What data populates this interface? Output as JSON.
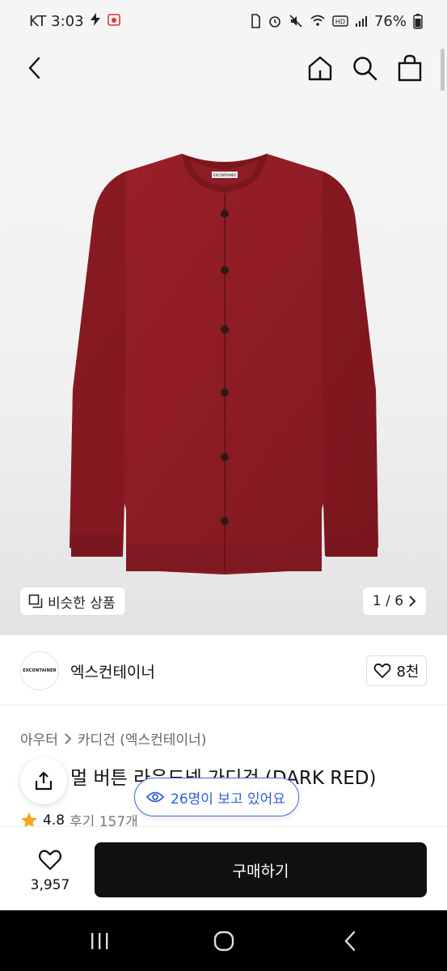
{
  "status_bar": {
    "carrier_time": "KT 3:03",
    "battery": "76%"
  },
  "nav": {
    "icons": [
      "back-arrow-icon",
      "home-icon",
      "search-icon",
      "shopping-bag-icon"
    ]
  },
  "product_image": {
    "similar_label": "비슷한 상품",
    "pager": "1 / 6",
    "garment_label": "EXCONTAINER",
    "colors": {
      "cardigan": "#8e1c24",
      "cardigan_shadow": "#6f141b",
      "button": "#2b1a17"
    }
  },
  "brand": {
    "logo_text": "EXCONTAINER",
    "name": "엑스컨테이너",
    "likes": "8천"
  },
  "breadcrumb": {
    "items": [
      "아우터",
      "카디건 (엑스컨테이너)"
    ]
  },
  "product": {
    "title": "모헤어 블렌드 컬러 버튼 라운드넥 가디건 (DARK RED)",
    "title_visible": "멀 버튼 라운드넥 가디건 (DARK RED)",
    "rating": "4.8",
    "reviews": "후기 157개"
  },
  "viewers": {
    "text": "26명이 보고 있어요"
  },
  "bottom_bar": {
    "wish_count": "3,957",
    "buy_label": "구매하기"
  },
  "colors": {
    "accent_blue": "#2f62d6",
    "star": "#f5a623",
    "buy_button": "#111111"
  }
}
